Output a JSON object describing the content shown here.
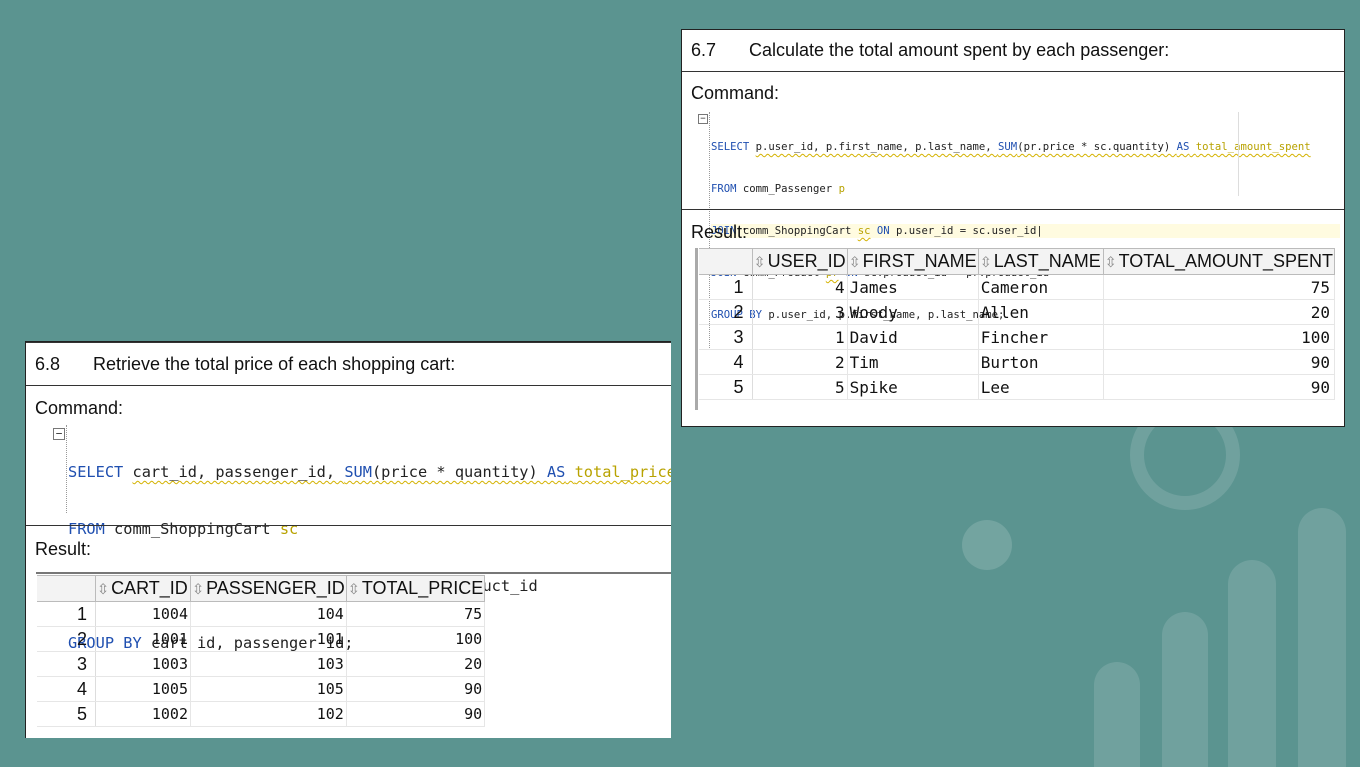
{
  "panel_67": {
    "number": "6.7",
    "title": "Calculate the total amount spent by each passenger:",
    "command_label": "Command:",
    "sql_lines": [
      "SELECT p.user_id, p.first_name, p.last_name, SUM(pr.price * sc.quantity) AS total_amount_spent",
      "FROM comm_Passenger p",
      "JOIN comm_ShoppingCart sc ON p.user_id = sc.user_id",
      "JOIN comm_Product pr ON sc.product_id = pr.product_id",
      "GROUP BY p.user_id, p.first_name, p.last_name;"
    ],
    "result_label": "Result:",
    "columns": [
      "USER_ID",
      "FIRST_NAME",
      "LAST_NAME",
      "TOTAL_AMOUNT_SPENT"
    ],
    "rows": [
      {
        "n": "1",
        "user_id": "4",
        "first_name": "James",
        "last_name": "Cameron",
        "total": "75"
      },
      {
        "n": "2",
        "user_id": "3",
        "first_name": "Woody",
        "last_name": "Allen",
        "total": "20"
      },
      {
        "n": "3",
        "user_id": "1",
        "first_name": "David",
        "last_name": "Fincher",
        "total": "100"
      },
      {
        "n": "4",
        "user_id": "2",
        "first_name": "Tim",
        "last_name": "Burton",
        "total": "90"
      },
      {
        "n": "5",
        "user_id": "5",
        "first_name": "Spike",
        "last_name": "Lee",
        "total": "90"
      }
    ]
  },
  "panel_68": {
    "number": "6.8",
    "title": "Retrieve the total price of each shopping cart:",
    "command_label": "Command:",
    "sql_lines": [
      "SELECT cart_id, passenger_id, SUM(price * quantity) AS total_price",
      "FROM comm_ShoppingCart sc",
      "JOIN comm_Product p ON sc.product_id = p.product_id",
      "GROUP BY cart_id, passenger_id;"
    ],
    "result_label": "Result:",
    "columns": [
      "CART_ID",
      "PASSENGER_ID",
      "TOTAL_PRICE"
    ],
    "rows": [
      {
        "n": "1",
        "cart_id": "1004",
        "passenger_id": "104",
        "total_price": "75"
      },
      {
        "n": "2",
        "cart_id": "1001",
        "passenger_id": "101",
        "total_price": "100"
      },
      {
        "n": "3",
        "cart_id": "1003",
        "passenger_id": "103",
        "total_price": "20"
      },
      {
        "n": "4",
        "cart_id": "1005",
        "passenger_id": "105",
        "total_price": "90"
      },
      {
        "n": "5",
        "cart_id": "1002",
        "passenger_id": "102",
        "total_price": "90"
      }
    ]
  },
  "colors": {
    "background": "#5b9490",
    "keyword": "#1f4fb0",
    "alias": "#b8a200"
  },
  "icons": {
    "collapse": "minus-box-icon",
    "sort": "sort-arrows-icon"
  }
}
